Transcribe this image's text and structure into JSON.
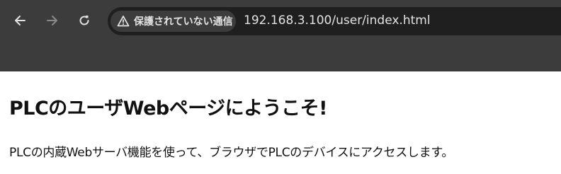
{
  "browser": {
    "security_label": "保護されていない通信",
    "url": "192.168.3.100/user/index.html",
    "icons": {
      "back": "back-arrow-icon",
      "forward": "forward-arrow-icon",
      "reload": "reload-icon",
      "security": "warning-triangle-icon"
    }
  },
  "page": {
    "heading": "PLCのユーザWebページにようこそ!",
    "paragraph": "PLCの内蔵Webサーバ機能を使って、ブラウザでPLCのデバイスにアクセスします。"
  }
}
